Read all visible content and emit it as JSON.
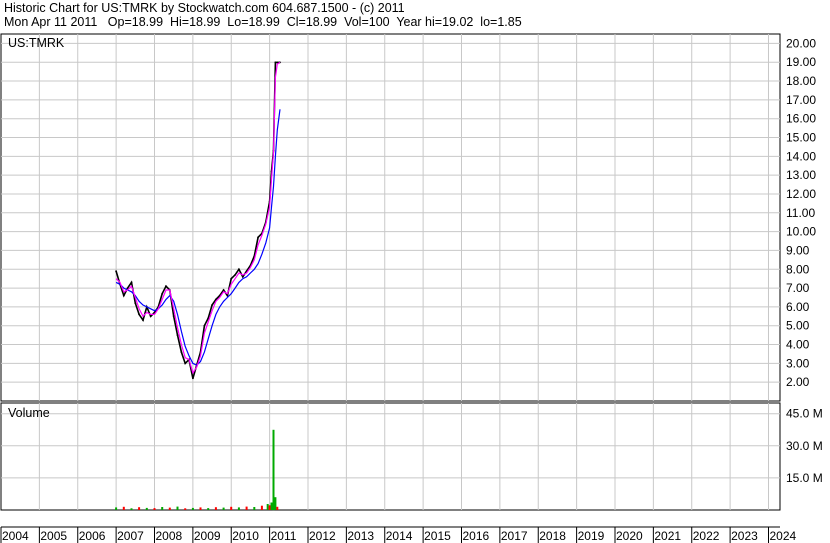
{
  "header": {
    "line1": "Historic Chart for US:TMRK by Stockwatch.com 604.687.1500 - (c) 2011",
    "line2": "Mon Apr 11 2011   Op=18.99  Hi=18.99  Lo=18.99  Cl=18.99  Vol=100  Year hi=19.02  lo=1.85"
  },
  "colors": {
    "price": "#000000",
    "ma_short": "#ff00ff",
    "ma_long": "#0000ff",
    "volume_down": "#ff0000",
    "volume_up": "#00aa00",
    "grid": "#c8c8c8"
  },
  "chart_data": [
    {
      "type": "line",
      "panel": "price",
      "label": "US:TMRK",
      "y_ticks": [
        "2.00",
        "3.00",
        "4.00",
        "5.00",
        "6.00",
        "7.00",
        "8.00",
        "9.00",
        "10.00",
        "11.00",
        "12.00",
        "13.00",
        "14.00",
        "15.00",
        "16.00",
        "17.00",
        "18.00",
        "19.00",
        "20.00"
      ],
      "ylim": [
        1.0,
        20.5
      ],
      "xlim": [
        2004.0,
        2024.3
      ],
      "x_ticks": [
        "2004",
        "2005",
        "2006",
        "2007",
        "2008",
        "2009",
        "2010",
        "2011",
        "2012",
        "2013",
        "2014",
        "2015",
        "2016",
        "2017",
        "2018",
        "2019",
        "2020",
        "2021",
        "2022",
        "2023",
        "2024"
      ],
      "x": [
        2007.0,
        2007.1,
        2007.2,
        2007.3,
        2007.4,
        2007.5,
        2007.6,
        2007.7,
        2007.8,
        2007.9,
        2008.0,
        2008.1,
        2008.2,
        2008.3,
        2008.4,
        2008.5,
        2008.6,
        2008.7,
        2008.8,
        2008.9,
        2009.0,
        2009.1,
        2009.2,
        2009.3,
        2009.4,
        2009.5,
        2009.6,
        2009.7,
        2009.8,
        2009.9,
        2010.0,
        2010.1,
        2010.2,
        2010.3,
        2010.4,
        2010.5,
        2010.6,
        2010.7,
        2010.8,
        2010.9,
        2011.0,
        2011.05,
        2011.1,
        2011.15,
        2011.2,
        2011.27
      ],
      "series": [
        {
          "role": "close",
          "values": [
            7.9,
            7.2,
            6.6,
            7.0,
            7.3,
            6.2,
            5.6,
            5.3,
            6.0,
            5.5,
            5.7,
            6.0,
            6.7,
            7.1,
            6.9,
            5.5,
            4.5,
            3.6,
            3.0,
            3.2,
            2.2,
            2.9,
            3.6,
            5.0,
            5.4,
            6.1,
            6.4,
            6.6,
            6.9,
            6.6,
            7.5,
            7.7,
            8.0,
            7.6,
            7.9,
            8.2,
            8.7,
            9.7,
            9.9,
            10.5,
            11.6,
            13.2,
            14.3,
            18.99,
            18.99,
            18.99
          ]
        },
        {
          "role": "ma_short",
          "values": [
            7.5,
            7.3,
            6.8,
            6.9,
            7.1,
            6.5,
            5.9,
            5.5,
            5.7,
            5.6,
            5.6,
            5.9,
            6.4,
            6.9,
            6.9,
            5.9,
            4.9,
            4.0,
            3.3,
            3.2,
            2.5,
            2.8,
            3.4,
            4.6,
            5.2,
            5.8,
            6.3,
            6.5,
            6.8,
            6.7,
            7.2,
            7.5,
            7.8,
            7.7,
            7.8,
            8.1,
            8.5,
            9.3,
            9.8,
            10.4,
            11.3,
            12.8,
            14.2,
            18.2,
            18.9,
            18.99
          ]
        },
        {
          "role": "ma_long",
          "values": [
            7.3,
            7.2,
            7.0,
            6.9,
            6.8,
            6.6,
            6.3,
            6.1,
            6.0,
            5.9,
            5.8,
            5.9,
            6.1,
            6.4,
            6.6,
            6.3,
            5.6,
            4.7,
            3.9,
            3.4,
            3.0,
            2.9,
            3.1,
            3.6,
            4.3,
            5.0,
            5.6,
            6.0,
            6.3,
            6.5,
            6.7,
            7.0,
            7.3,
            7.5,
            7.6,
            7.8,
            8.0,
            8.3,
            8.8,
            9.4,
            10.2,
            11.3,
            12.4,
            14.0,
            15.4,
            16.5
          ]
        }
      ]
    },
    {
      "type": "bar",
      "panel": "volume",
      "label": "Volume",
      "y_ticks": [
        "15.0 M",
        "30.0 M",
        "45.0 M"
      ],
      "ylim": [
        0,
        50
      ],
      "x": [
        2007.0,
        2007.2,
        2007.4,
        2007.6,
        2007.8,
        2008.0,
        2008.2,
        2008.4,
        2008.6,
        2008.8,
        2009.0,
        2009.2,
        2009.4,
        2009.6,
        2009.8,
        2010.0,
        2010.2,
        2010.4,
        2010.6,
        2010.8,
        2010.95,
        2011.0,
        2011.05,
        2011.1,
        2011.15,
        2011.2
      ],
      "values": [
        1.2,
        1.5,
        0.8,
        1.3,
        1.0,
        0.9,
        1.4,
        1.1,
        1.6,
        0.8,
        1.0,
        1.2,
        0.9,
        1.3,
        1.1,
        1.5,
        1.2,
        1.6,
        1.4,
        2.0,
        2.8,
        2.2,
        3.5,
        37.5,
        6.0,
        1.5
      ]
    }
  ]
}
